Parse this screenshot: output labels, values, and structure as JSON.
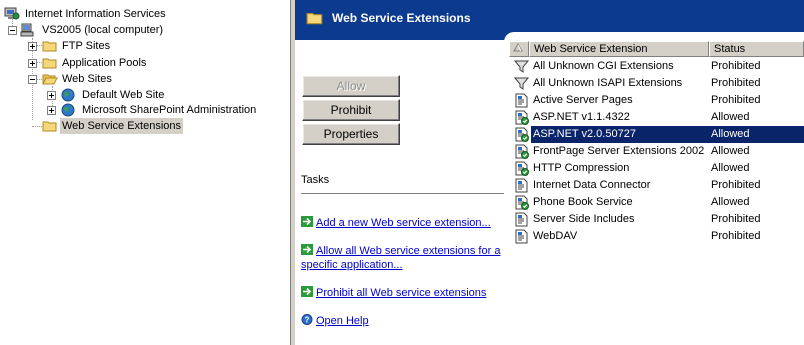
{
  "tree": {
    "root": "Internet Information Services",
    "server": "VS2005 (local computer)",
    "ftp_sites": "FTP Sites",
    "app_pools": "Application Pools",
    "web_sites": "Web Sites",
    "default_site": "Default Web Site",
    "sharepoint_admin": "Microsoft SharePoint Administration",
    "web_service_extensions": "Web Service Extensions"
  },
  "banner": {
    "title": "Web Service Extensions"
  },
  "buttons": {
    "allow": "Allow",
    "prohibit": "Prohibit",
    "properties": "Properties"
  },
  "tasks": {
    "title": "Tasks",
    "add_new": "Add a new Web service extension...",
    "allow_all_line1": "Allow all Web service extensions for a",
    "allow_all_line2": "specific application...",
    "prohibit_all": "Prohibit all Web service extensions",
    "open_help": "Open Help"
  },
  "list": {
    "columns": {
      "name": "Web Service Extension",
      "status": "Status"
    },
    "rows": [
      {
        "name": "All Unknown CGI Extensions",
        "status": "Prohibited",
        "icon": "filter-icon"
      },
      {
        "name": "All Unknown ISAPI Extensions",
        "status": "Prohibited",
        "icon": "filter-icon"
      },
      {
        "name": "Active Server Pages",
        "status": "Prohibited",
        "icon": "extension-icon"
      },
      {
        "name": "ASP.NET v1.1.4322",
        "status": "Allowed",
        "icon": "extension-allowed-icon"
      },
      {
        "name": "ASP.NET v2.0.50727",
        "status": "Allowed",
        "icon": "extension-allowed-icon"
      },
      {
        "name": "FrontPage Server Extensions 2002",
        "status": "Allowed",
        "icon": "extension-allowed-icon"
      },
      {
        "name": "HTTP Compression",
        "status": "Allowed",
        "icon": "extension-allowed-icon"
      },
      {
        "name": "Internet Data Connector",
        "status": "Prohibited",
        "icon": "extension-icon"
      },
      {
        "name": "Phone Book Service",
        "status": "Allowed",
        "icon": "extension-allowed-icon"
      },
      {
        "name": "Server Side Includes",
        "status": "Prohibited",
        "icon": "extension-icon"
      },
      {
        "name": "WebDAV",
        "status": "Prohibited",
        "icon": "extension-icon"
      }
    ],
    "selected_index": 4
  },
  "colors": {
    "banner": "#0b3a8e",
    "selection": "#0a246a",
    "link": "#0000cc",
    "chrome": "#d4d0c8"
  }
}
